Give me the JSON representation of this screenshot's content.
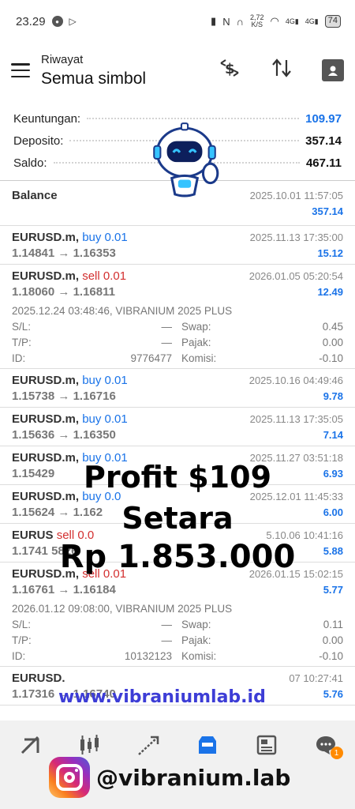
{
  "status_bar": {
    "time": "23.29",
    "network_speed": "2,72",
    "network_unit": "K/S",
    "signal_1": "4G",
    "signal_2": "4G",
    "battery": "74"
  },
  "header": {
    "subtitle": "Riwayat",
    "title": "Semua simbol"
  },
  "summary": {
    "profit_label": "Keuntungan:",
    "profit_value": "109.97",
    "deposit_label": "Deposito:",
    "deposit_value": "357.14",
    "balance_label": "Saldo:",
    "balance_value": "467.11"
  },
  "balance_entry": {
    "label": "Balance",
    "time": "2025.10.01 11:57:05",
    "amount": "357.14"
  },
  "detail_labels": {
    "sl": "S/L:",
    "tp": "T/P:",
    "id": "ID:",
    "swap": "Swap:",
    "tax": "Pajak:",
    "commission": "Komisi:"
  },
  "trades": [
    {
      "symbol": "EURUSD.m,",
      "side": "buy 0.01",
      "time": "2025.11.13 17:35:00",
      "open": "1.14841",
      "arrow": "→",
      "close": "1.16353",
      "profit": "15.12"
    },
    {
      "symbol": "EURUSD.m,",
      "side": "sell 0.01",
      "time": "2026.01.05 05:20:54",
      "open": "1.18060",
      "arrow": "→",
      "close": "1.16811",
      "profit": "12.49",
      "meta": "2025.12.24 03:48:46, VIBRANIUM 2025 PLUS",
      "sl": "—",
      "tp": "—",
      "id": "9776477",
      "swap": "0.45",
      "tax": "0.00",
      "commission": "-0.10"
    },
    {
      "symbol": "EURUSD.m,",
      "side": "buy 0.01",
      "time": "2025.10.16 04:49:46",
      "open": "1.15738",
      "arrow": "→",
      "close": "1.16716",
      "profit": "9.78"
    },
    {
      "symbol": "EURUSD.m,",
      "side": "buy 0.01",
      "time": "2025.11.13 17:35:05",
      "open": "1.15636",
      "arrow": "→",
      "close": "1.16350",
      "profit": "7.14"
    },
    {
      "symbol": "EURUSD.m,",
      "side": "buy 0.01",
      "time": "2025.11.27 03:51:18",
      "open": "1.15429",
      "arrow": "",
      "close": "",
      "profit": "6.93"
    },
    {
      "symbol": "EURUSD.m,",
      "side": "buy 0.0",
      "time": "2025.12.01 11:45:33",
      "open": "1.15624",
      "arrow": "→",
      "close": "1.162",
      "profit": "6.00"
    },
    {
      "symbol": "EURUS",
      "side": "sell 0.0",
      "time": "5.10.06 10:41:16",
      "open": "1.1741",
      "arrow": "",
      "close": "5826",
      "profit": "5.88"
    },
    {
      "symbol": "EURUSD.m,",
      "side": "sell 0.01",
      "time": "2026.01.15 15:02:15",
      "open": "1.16761",
      "arrow": "→",
      "close": "1.16184",
      "profit": "5.77",
      "meta": "2026.01.12 09:08:00, VIBRANIUM 2025 PLUS",
      "sl": "—",
      "tp": "—",
      "id": "10132123",
      "swap": "0.11",
      "tax": "0.00",
      "commission": "-0.10"
    },
    {
      "symbol": "EURUSD.",
      "side": "",
      "time": "07 10:27:41",
      "open": "1.17316",
      "arrow": "→",
      "close": "1.16740",
      "profit": "5.76"
    }
  ],
  "overlay": {
    "line1": "Profit $109",
    "line2": "Setara",
    "line3": "Rp 1.853.000",
    "url": "www.vibraniumlab.id",
    "instagram": "@vibranium.lab"
  },
  "nav": {
    "badge": "1"
  },
  "colors": {
    "buy": "#1a73e8",
    "sell": "#d32f2f",
    "profit": "#1a73e8"
  }
}
